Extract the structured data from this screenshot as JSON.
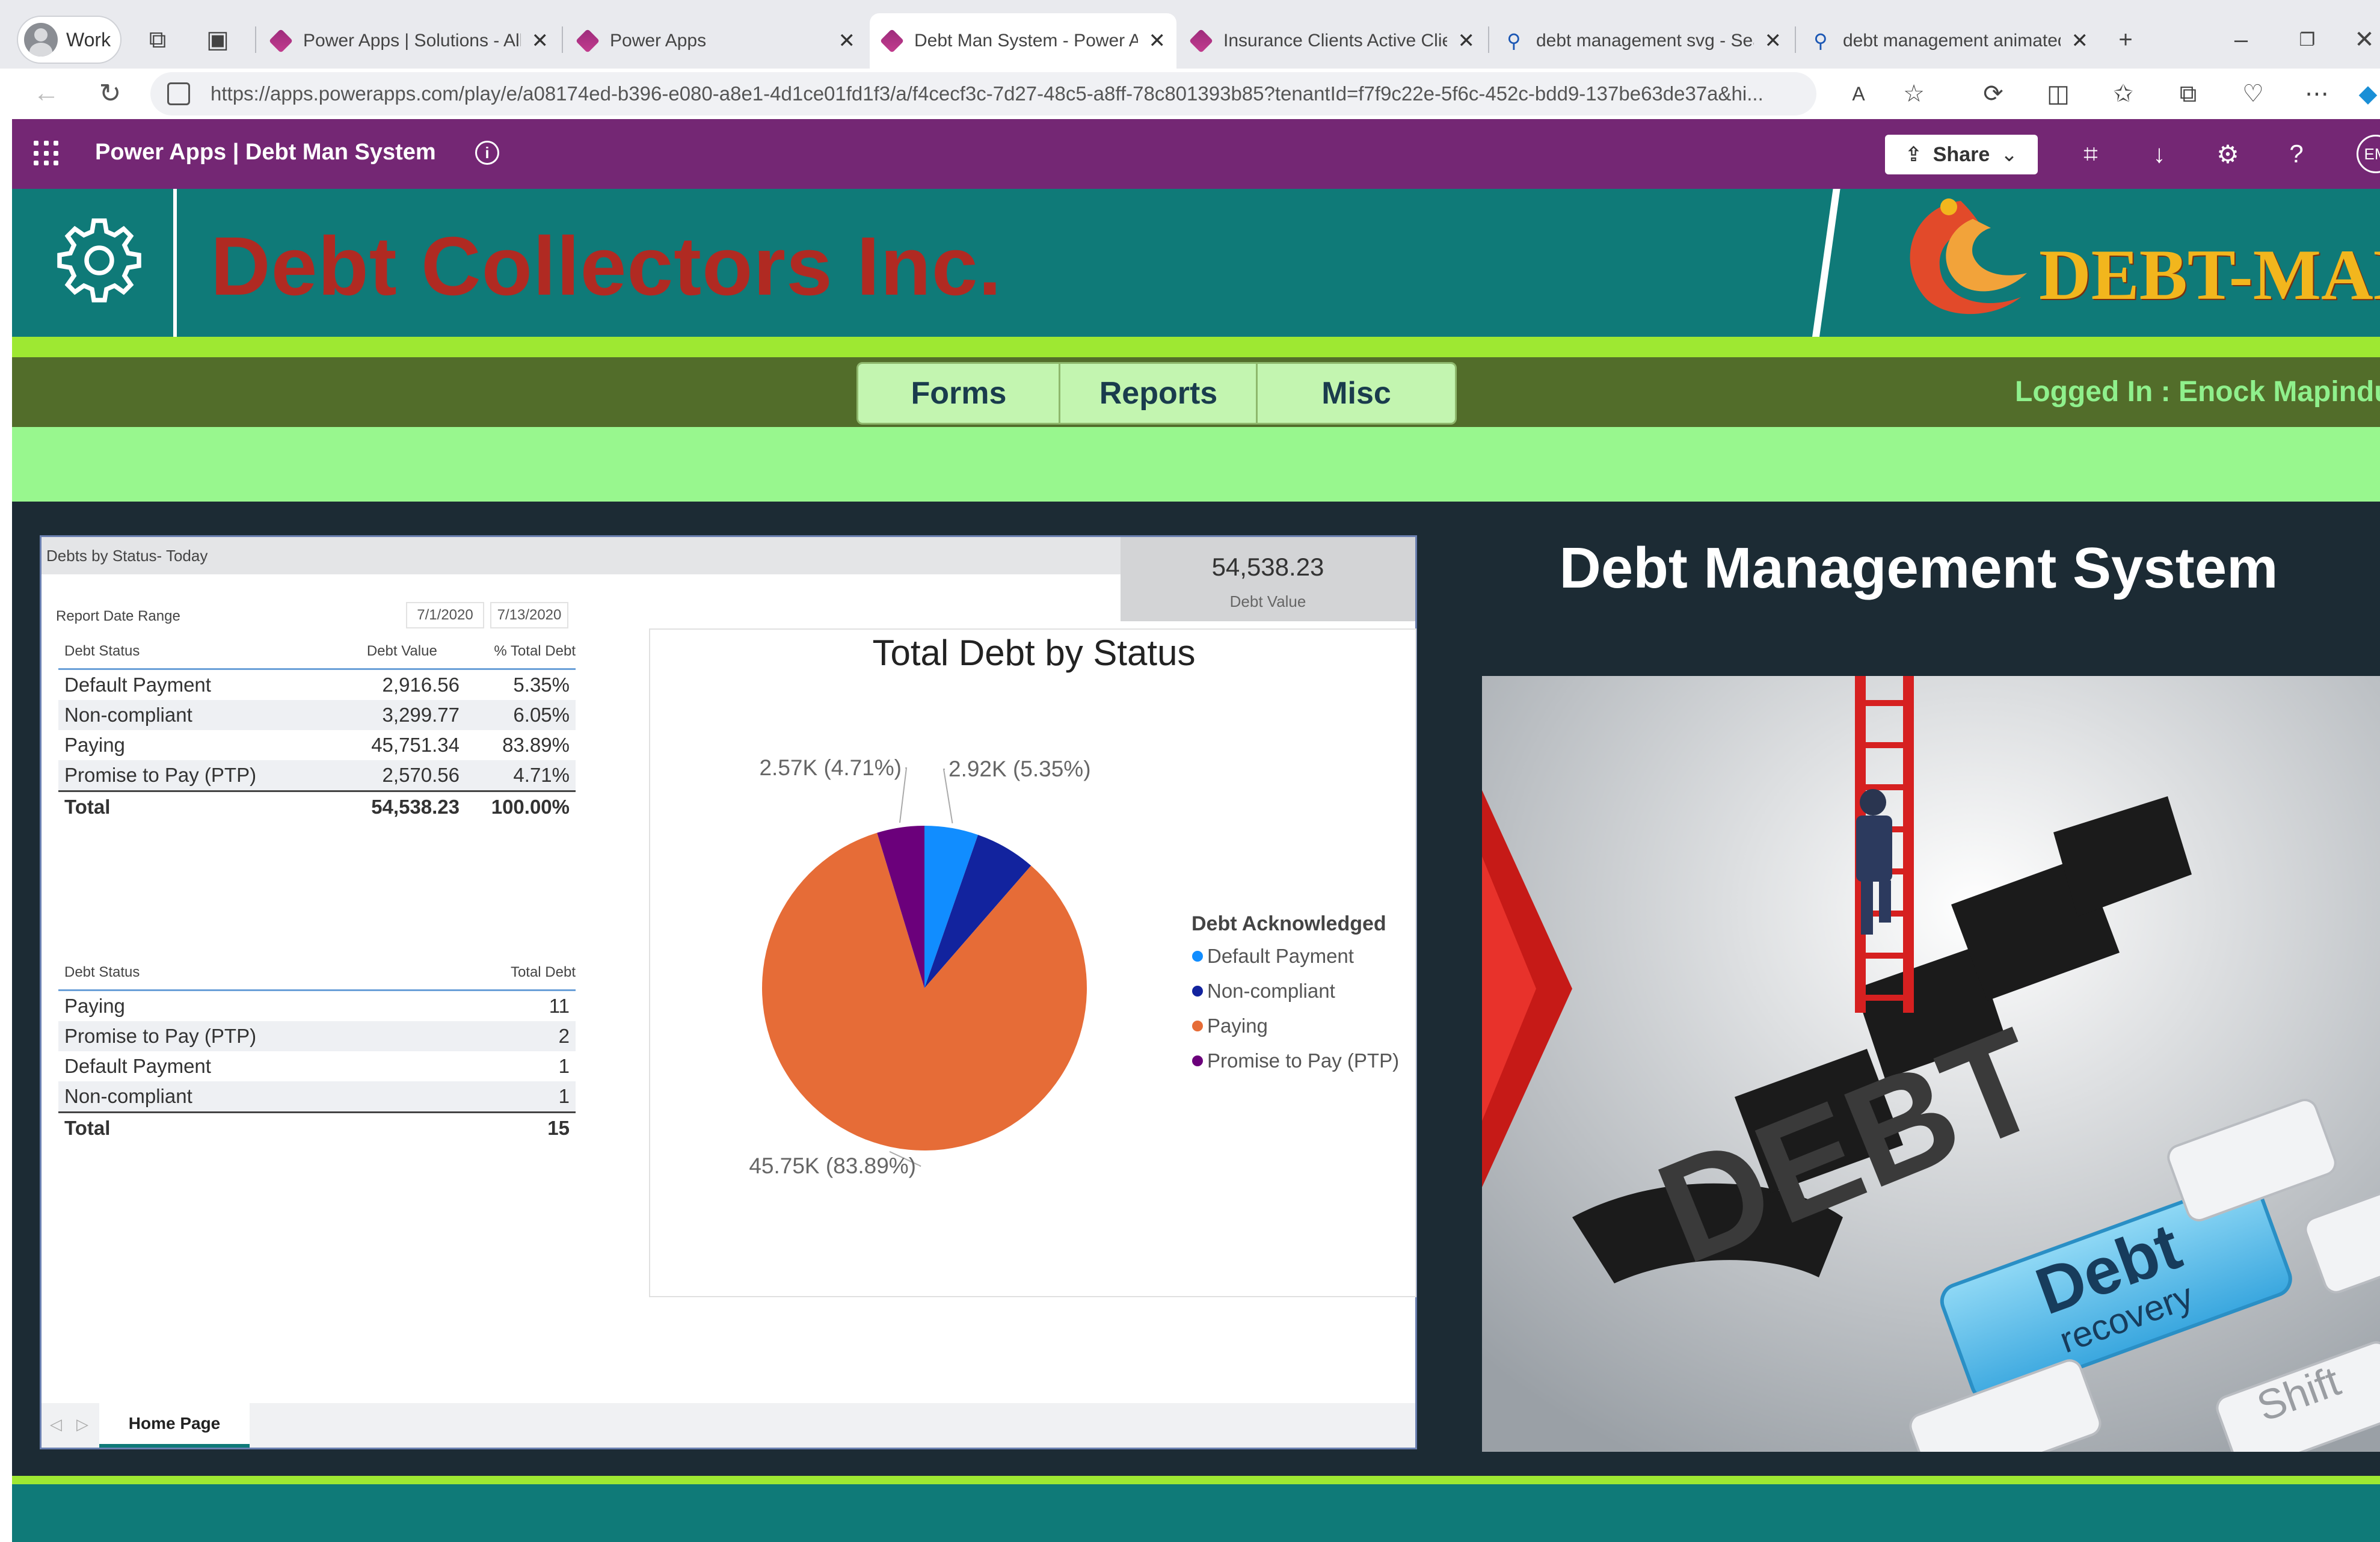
{
  "browser": {
    "profile_label": "Work",
    "tabs": [
      {
        "label": "Power Apps | Solutions - All",
        "icon": "powerapps-icon"
      },
      {
        "label": "Power Apps",
        "icon": "powerapps-icon"
      },
      {
        "label": "Debt Man System - Power A",
        "icon": "powerapps-icon",
        "active": true
      },
      {
        "label": "Insurance Clients Active Clie",
        "icon": "powerapps-icon"
      },
      {
        "label": "debt management svg - Sea",
        "icon": "search-icon"
      },
      {
        "label": "debt management animated",
        "icon": "search-icon"
      }
    ],
    "new_tab": "+",
    "url": "https://apps.powerapps.com/play/e/a08174ed-b396-e080-a8e1-4d1ce01fd1f3/a/f4cecf3c-7d27-48c5-a8ff-78c801393b85?tenantId=f7f9c22e-5f6c-452c-bdd9-137be63de37a&hi..."
  },
  "app_header": {
    "title": "Power Apps  |  Debt Man System",
    "share_label": "Share",
    "avatar_initials": "EM"
  },
  "banner": {
    "company": "Debt Collectors Inc.",
    "logo_text": "DEBT-MAN"
  },
  "nav": {
    "tabs": [
      "Forms",
      "Reports",
      "Misc"
    ],
    "logged_in": "Logged In : Enock Mapindu"
  },
  "report": {
    "title": "Debts by Status- Today",
    "kpi_value": "54,538.23",
    "kpi_label": "Debt Value",
    "date_range_label": "Report Date Range",
    "date_from": "7/1/2020",
    "date_to": "7/13/2020",
    "table1": {
      "headers": [
        "Debt Status",
        "Debt Value",
        "% Total Debt"
      ],
      "rows": [
        [
          "Default Payment",
          "2,916.56",
          "5.35%"
        ],
        [
          "Non-compliant",
          "3,299.77",
          "6.05%"
        ],
        [
          "Paying",
          "45,751.34",
          "83.89%"
        ],
        [
          "Promise to Pay (PTP)",
          "2,570.56",
          "4.71%"
        ]
      ],
      "total": [
        "Total",
        "54,538.23",
        "100.00%"
      ]
    },
    "table2": {
      "headers": [
        "Debt Status",
        "Total Debt"
      ],
      "rows": [
        [
          "Paying",
          "11"
        ],
        [
          "Promise to Pay (PTP)",
          "2"
        ],
        [
          "Default Payment",
          "1"
        ],
        [
          "Non-compliant",
          "1"
        ]
      ],
      "total": [
        "Total",
        "15"
      ]
    },
    "page_tab": "Home Page"
  },
  "chart_data": {
    "type": "pie",
    "title": "Total  Debt by Status",
    "legend_title": "Debt Acknowledged",
    "legend_position": "right",
    "series": [
      {
        "name": "Default Payment",
        "value": 2916.56,
        "percent": 5.35,
        "label": "2.92K (5.35%)",
        "color": "#118dff"
      },
      {
        "name": "Non-compliant",
        "value": 3299.77,
        "percent": 6.05,
        "label": "",
        "color": "#12239e"
      },
      {
        "name": "Paying",
        "value": 45751.34,
        "percent": 83.89,
        "label": "45.75K (83.89%)",
        "color": "#e66c37"
      },
      {
        "name": "Promise to Pay (PTP)",
        "value": 2570.56,
        "percent": 4.71,
        "label": "2.57K (4.71%)",
        "color": "#6b007b"
      }
    ]
  },
  "right_panel": {
    "title": "Debt Management System",
    "hero_key_text_1": "Debt",
    "hero_key_text_2": "recovery",
    "hero_shift_text": "Shift",
    "hero_big_text": "DEBT"
  },
  "colors": {
    "app_bar": "#742774",
    "teal": "#0f7a78",
    "company_red": "#b02a22",
    "lime": "#9ee832"
  }
}
